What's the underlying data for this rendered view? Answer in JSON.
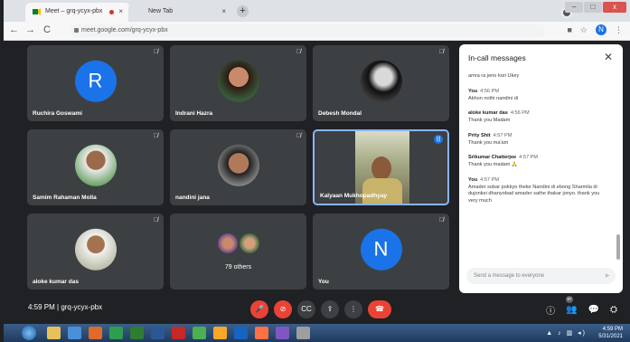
{
  "browser": {
    "tabs": [
      {
        "title": "Meet – grq-ycyx-pbx",
        "close": "×"
      },
      {
        "title": "New Tab",
        "close": "×"
      }
    ],
    "new_tab": "+",
    "nav": {
      "back": "←",
      "forward": "→",
      "reload": "C"
    },
    "url": "meet.google.com/grq-ycyx-pbx",
    "profile_initial": "N",
    "window_controls": {
      "minimize": "–",
      "maximize": "□",
      "close": "x"
    }
  },
  "meet": {
    "meeting_code": "grq-ycyx-pbx",
    "time": "4:59 PM",
    "time_code_label": "4:59 PM  |  grq-ycyx-pbx",
    "participants": [
      {
        "name": "Ruchira Goswami",
        "type": "letter",
        "letter": "R"
      },
      {
        "name": "Indrani Hazra",
        "type": "photo"
      },
      {
        "name": "Debesh Mondal",
        "type": "photo"
      },
      {
        "name": "Samim Rahaman Molla",
        "type": "photo"
      },
      {
        "name": "nandini jana",
        "type": "photo"
      },
      {
        "name": "Kalyaan Mukhopadhyay",
        "type": "video",
        "speaking": true
      },
      {
        "name": "aloke kumar das",
        "type": "photo"
      },
      {
        "name": "",
        "type": "group",
        "others": "79 others"
      },
      {
        "name": "You",
        "type": "letter",
        "letter": "N"
      }
    ],
    "chat": {
      "title": "In-call messages",
      "close": "✕",
      "messages": [
        {
          "who": "",
          "time": "",
          "text": "amra ra jeno kori Ukey"
        },
        {
          "who": "You",
          "time": "4:56 PM",
          "text": "Akhon nothi nandini di"
        },
        {
          "who": "aloke kumar das",
          "time": "4:56 PM",
          "text": "Thank you Madam"
        },
        {
          "who": "Prity Shit",
          "time": "4:57 PM",
          "text": "Thank you ma'am"
        },
        {
          "who": "Srikumar Chatterjee",
          "time": "4:57 PM",
          "text": "Thank you madam 🙏"
        },
        {
          "who": "You",
          "time": "4:57 PM",
          "text": "Amader sobar pokkyo theke Nandini di ebong Sharmila di dujonkei dhanyobad amader sathe thakar jonyo. thank you very much"
        }
      ],
      "input_placeholder": "Send a message to everyone",
      "send_icon": "➤"
    },
    "controls": {
      "mic": "🎤",
      "camera": "⊘",
      "captions": "CC",
      "present": "⇪",
      "more": "⋮",
      "end": "☎"
    },
    "right_controls": {
      "info": "ⓘ",
      "people": "👥",
      "people_count": "87",
      "chat": "💬",
      "activities": "⛭"
    }
  },
  "taskbar": {
    "tray_time": "4:59 PM",
    "tray_date": "5/31/2021",
    "tray_icons": "▲ ♪ ▥ ◂)"
  }
}
